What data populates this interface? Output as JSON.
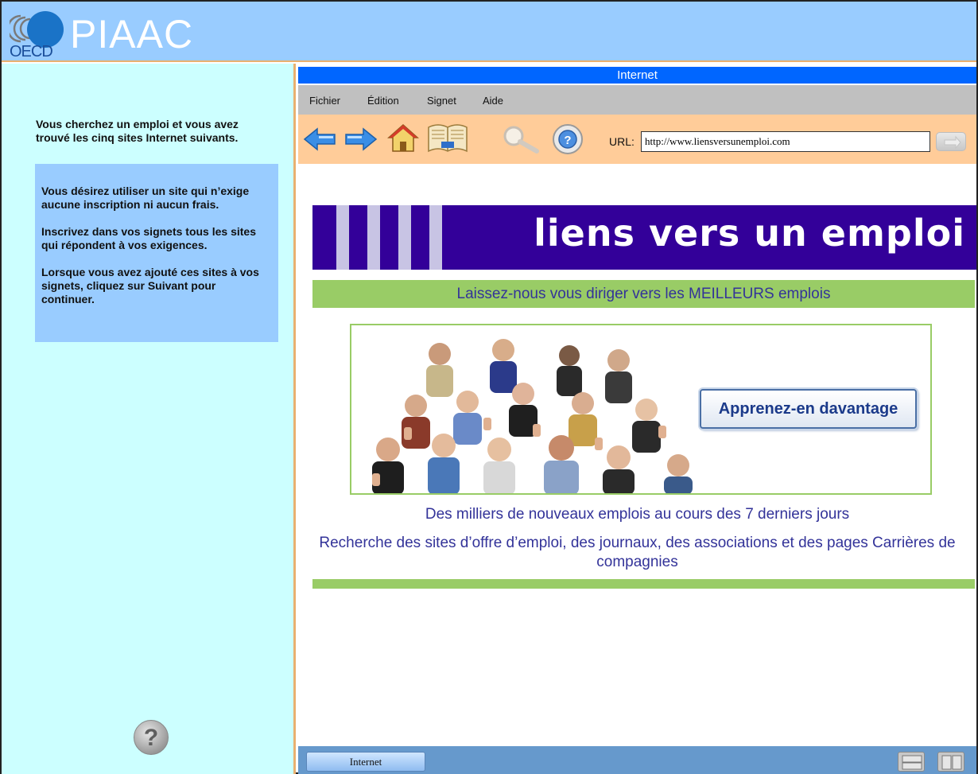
{
  "header": {
    "logo_text": "OECD",
    "brand": "PIAAC"
  },
  "left_panel": {
    "intro": "Vous cherchez un emploi et vous avez trouvé les cinq sites Internet suivants.",
    "task": [
      "Vous désirez utiliser un site qui n’exige aucune inscription ni aucun frais.",
      "Inscrivez dans vos signets tous les sites qui répondent à vos exigences.",
      "Lorsque vous avez ajouté ces sites à vos signets, cliquez sur Suivant pour continuer."
    ],
    "help_label": "?"
  },
  "browser": {
    "title": "Internet",
    "menu": [
      "Fichier",
      "Édition",
      "Signet",
      "Aide"
    ],
    "toolbar_icons": [
      "back-arrow-icon",
      "forward-arrow-icon",
      "home-icon",
      "bookmarks-book-icon",
      "search-magnifier-icon",
      "help-lifebuoy-icon"
    ],
    "url_label": "URL:",
    "url_value": "http://www.liensversunemploi.com"
  },
  "page": {
    "banner_title": "liens vers un emploi",
    "tagline": "Laissez-nous vous diriger vers les MEILLEURS emplois",
    "learn_more": "Apprenez-en davantage",
    "line1": "Des milliers de nouveaux emplois au cours des 7 derniers jours",
    "line2": "Recherche des sites d’offre d’emploi, des journaux, des associations et des pages Carrières de compagnies"
  },
  "taskbar": {
    "tab_label": "Internet"
  },
  "colors": {
    "header_bg": "#99ccff",
    "left_bg": "#ccffff",
    "task_bg": "#99ccff",
    "titlebar": "#0066ff",
    "toolbar_bg": "#ffcc99",
    "banner_bg": "#330099",
    "accent_green": "#99cc66",
    "text_blue": "#333399"
  }
}
